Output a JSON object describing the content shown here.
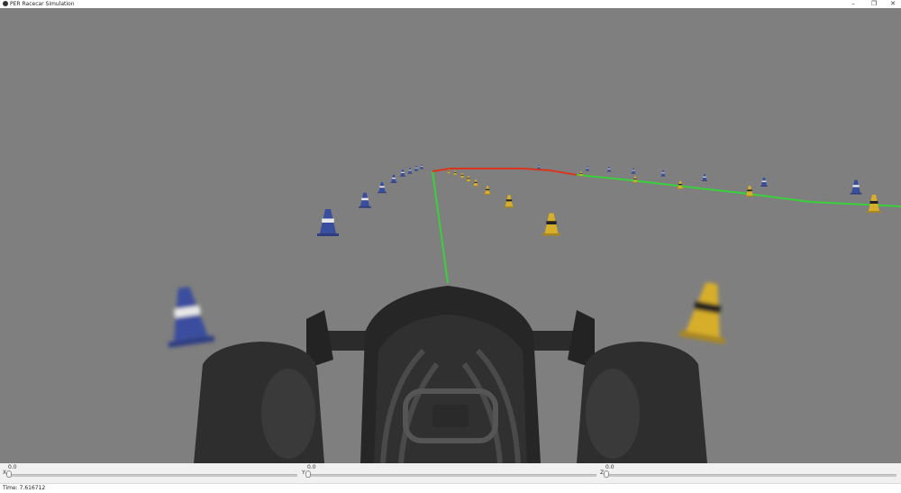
{
  "window": {
    "title": "PER Racecar Simulation",
    "minimize_glyph": "–",
    "maximize_glyph": "❐",
    "close_glyph": "✕"
  },
  "sliders": [
    {
      "axis": "X",
      "value": "0.0"
    },
    {
      "axis": "Y",
      "value": "0.0"
    },
    {
      "axis": "Z",
      "value": "0.0"
    }
  ],
  "status": {
    "time_text": "Time: 7.616712"
  },
  "colors": {
    "background": "#7f7f7f",
    "blue_cone": "#3a4e9e",
    "yellow_cone": "#d7ae2a",
    "path_green": "#39d13b",
    "path_red": "#d9351f",
    "car_body": "#262626"
  },
  "icons": [
    "app-icon",
    "minimize-icon",
    "maximize-icon",
    "close-icon"
  ]
}
